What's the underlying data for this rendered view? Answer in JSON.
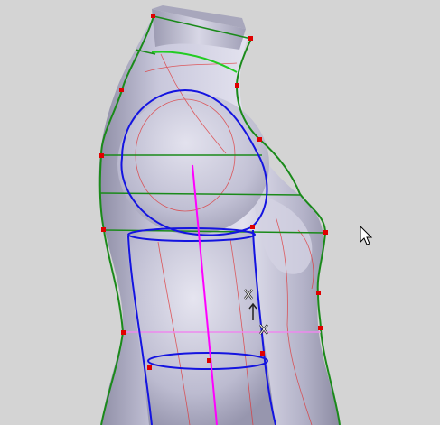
{
  "viewport": {
    "background": "#d4d4d4",
    "model_fill": "#b9b8cc",
    "outline_color": "#1a8a1a",
    "section_color": "#1a8a1a",
    "arm_guide_color": "#1414e0",
    "axis_color": "#ff00ff",
    "detail_color": "#e03030",
    "control_point_color": "#e00000",
    "cursor_icon": "arrow-pointer-icon",
    "move_gizmo_icon": "move-handle-icon"
  }
}
